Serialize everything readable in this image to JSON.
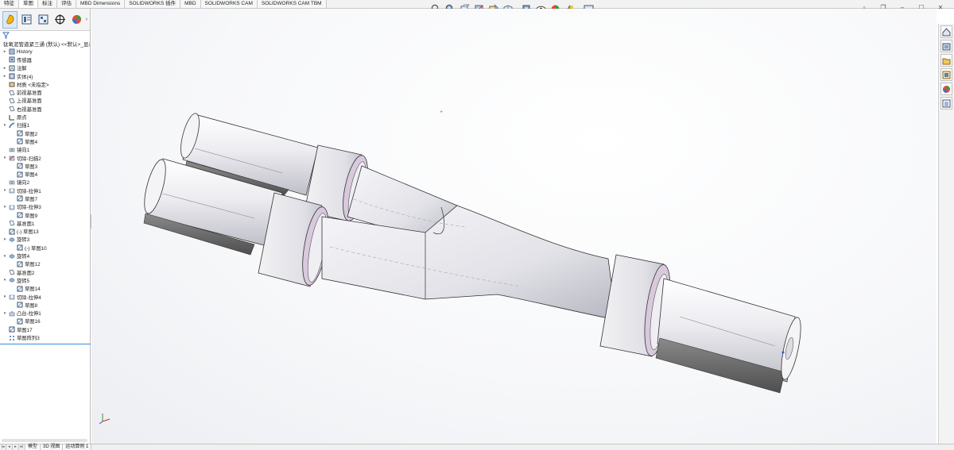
{
  "command_tabs": [
    "特征",
    "草图",
    "标注",
    "评估",
    "MBD Dimensions",
    "SOLIDWORKS 插件",
    "MBD",
    "SOLIDWORKS CAM",
    "SOLIDWORKS CAM TBM"
  ],
  "active_command_tab": 1,
  "hud_tools": [
    "zoom-to-fit-icon",
    "zoom-to-area-icon",
    "previous-view-icon",
    "section-view-icon",
    "dynamic-annotation-icon",
    "view-orientation-icon",
    "display-style-icon",
    "hide-show-icon",
    "edit-appearance-icon",
    "apply-scene-icon",
    "view-settings-icon"
  ],
  "panel_tabs": [
    "feature-manager-icon",
    "property-manager-icon",
    "configuration-manager-icon",
    "dimxpert-icon"
  ],
  "root_label": "钛氧泥管道紧三通 (默认) <<默认>_显示",
  "tree": [
    {
      "label": "History",
      "icon": "history-icon",
      "exp": "▸",
      "indent": 0
    },
    {
      "label": "传感器",
      "icon": "sensor-icon",
      "exp": "",
      "indent": 0
    },
    {
      "label": "注解",
      "icon": "annotation-icon",
      "exp": "▸",
      "indent": 0
    },
    {
      "label": "实体(4)",
      "icon": "solid-bodies-icon",
      "exp": "▸",
      "indent": 0
    },
    {
      "label": "材质 <未指定>",
      "icon": "material-icon",
      "exp": "",
      "indent": 0
    },
    {
      "label": "前视基准面",
      "icon": "plane-icon",
      "exp": "",
      "indent": 0
    },
    {
      "label": "上视基准面",
      "icon": "plane-icon",
      "exp": "",
      "indent": 0
    },
    {
      "label": "右视基准面",
      "icon": "plane-icon",
      "exp": "",
      "indent": 0
    },
    {
      "label": "原点",
      "icon": "origin-icon",
      "exp": "",
      "indent": 0
    },
    {
      "label": "扫描1",
      "icon": "sweep-icon",
      "exp": "▾",
      "indent": 0
    },
    {
      "label": "草图2",
      "icon": "sketch-icon",
      "exp": "",
      "indent": 1
    },
    {
      "label": "草图4",
      "icon": "sketch-icon",
      "exp": "",
      "indent": 1
    },
    {
      "label": "镜向1",
      "icon": "mirror-icon",
      "exp": "",
      "indent": 0
    },
    {
      "label": "切除-扫描2",
      "icon": "cut-sweep-icon",
      "exp": "▾",
      "indent": 0
    },
    {
      "label": "草图3",
      "icon": "sketch-icon",
      "exp": "",
      "indent": 1
    },
    {
      "label": "草图4",
      "icon": "sketch-icon",
      "exp": "",
      "indent": 1
    },
    {
      "label": "镜向2",
      "icon": "mirror-icon",
      "exp": "",
      "indent": 0
    },
    {
      "label": "切除-拉伸1",
      "icon": "cut-extrude-icon",
      "exp": "▾",
      "indent": 0
    },
    {
      "label": "草图7",
      "icon": "sketch-icon",
      "exp": "",
      "indent": 1
    },
    {
      "label": "切除-拉伸3",
      "icon": "cut-extrude-icon",
      "exp": "▾",
      "indent": 0
    },
    {
      "label": "草图9",
      "icon": "sketch-icon",
      "exp": "",
      "indent": 1
    },
    {
      "label": "基准面1",
      "icon": "plane-icon",
      "exp": "",
      "indent": 0
    },
    {
      "label": "(-) 草图13",
      "icon": "sketch-icon",
      "exp": "",
      "indent": 0
    },
    {
      "label": "旋转3",
      "icon": "revolve-icon",
      "exp": "▾",
      "indent": 0
    },
    {
      "label": "(-) 草图10",
      "icon": "sketch-icon",
      "exp": "",
      "indent": 1
    },
    {
      "label": "旋转4",
      "icon": "revolve-icon",
      "exp": "▾",
      "indent": 0
    },
    {
      "label": "草图12",
      "icon": "sketch-icon",
      "exp": "",
      "indent": 1
    },
    {
      "label": "基准面2",
      "icon": "plane-icon",
      "exp": "",
      "indent": 0
    },
    {
      "label": "旋转5",
      "icon": "revolve-icon",
      "exp": "▾",
      "indent": 0
    },
    {
      "label": "草图14",
      "icon": "sketch-icon",
      "exp": "",
      "indent": 1
    },
    {
      "label": "切除-拉伸4",
      "icon": "cut-extrude-icon",
      "exp": "▾",
      "indent": 0
    },
    {
      "label": "草图8",
      "icon": "sketch-icon",
      "exp": "",
      "indent": 1
    },
    {
      "label": "凸台-拉伸1",
      "icon": "boss-extrude-icon",
      "exp": "▾",
      "indent": 0
    },
    {
      "label": "草图16",
      "icon": "sketch-icon",
      "exp": "",
      "indent": 1
    },
    {
      "label": "草图17",
      "icon": "sketch-icon",
      "exp": "",
      "indent": 0
    },
    {
      "label": "草图阵列3",
      "icon": "sketch-pattern-icon",
      "exp": "",
      "indent": 0
    }
  ],
  "bottom_tabs": [
    "模型",
    "3D 视图",
    "运动算例 1"
  ],
  "active_bottom_tab": 0,
  "right_pane": [
    "solidworks-resources-icon",
    "design-library-icon",
    "file-explorer-icon",
    "view-palette-icon",
    "appearances-icon",
    "custom-properties-icon"
  ],
  "colors": {
    "accent": "#3c8bd6",
    "part_body": "#e9e9ee",
    "part_inner": "#d8c8dc",
    "cut_face": "#5f5f5f"
  }
}
